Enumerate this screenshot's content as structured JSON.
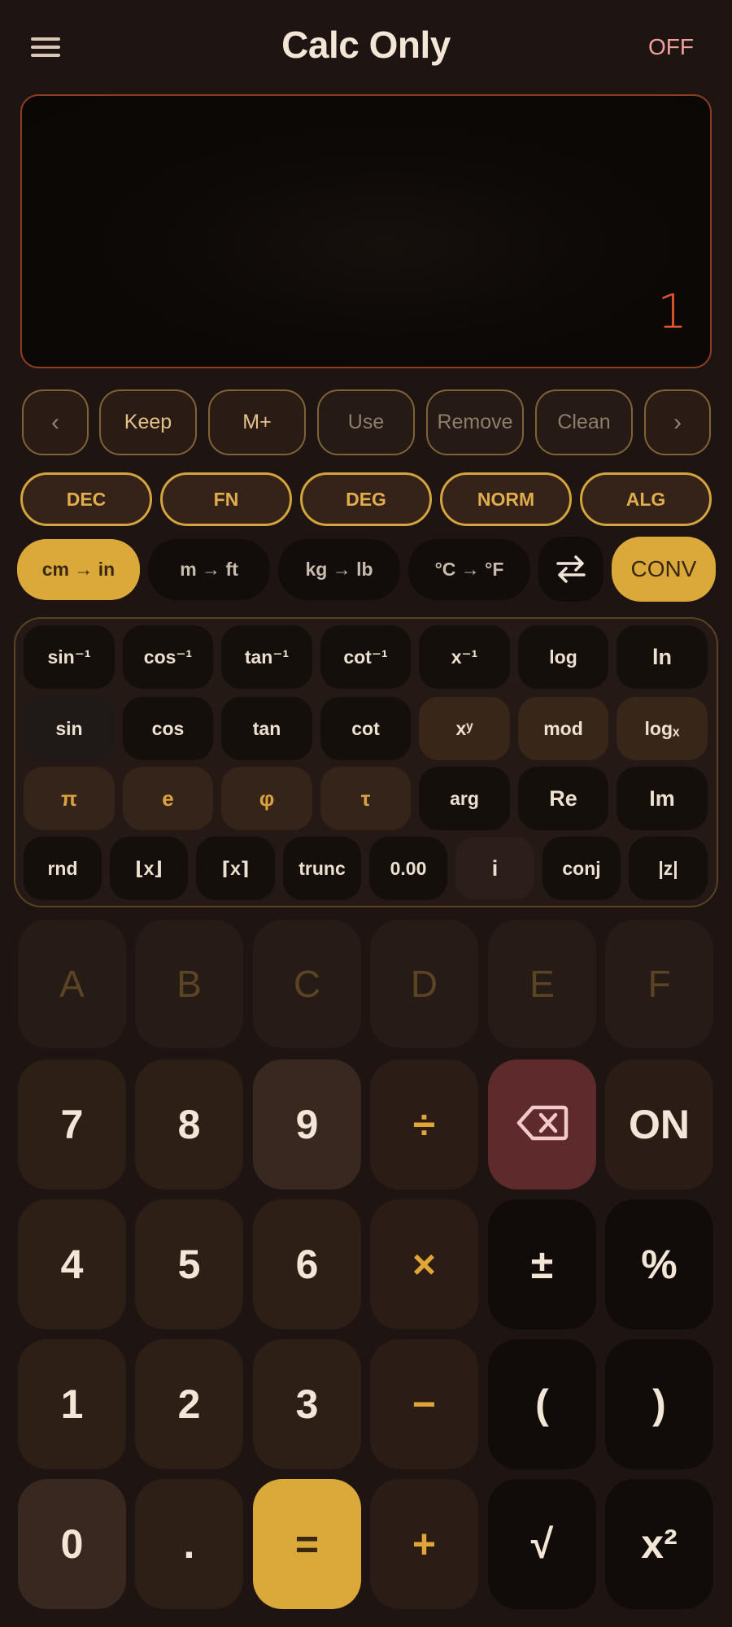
{
  "header": {
    "menu_icon": "hamburger-menu-icon",
    "title": "Calc Only",
    "off_label": "OFF"
  },
  "display": {
    "value": "1"
  },
  "memory": {
    "prev_arrow": "‹",
    "keep": "Keep",
    "mplus": "M+",
    "use": "Use",
    "remove": "Remove",
    "clean": "Clean",
    "next_arrow": "›"
  },
  "modes": [
    "DEC",
    "FN",
    "DEG",
    "NORM",
    "ALG"
  ],
  "units": {
    "cm_in": "cm → in",
    "m_ft": "m → ft",
    "kg_lb": "kg → lb",
    "c_f": "°C → °F",
    "swap_icon": "swap-arrows-icon",
    "conv": "CONV"
  },
  "scientific": {
    "row1": [
      "sin⁻¹",
      "cos⁻¹",
      "tan⁻¹",
      "cot⁻¹",
      "x⁻¹",
      "log",
      "ln"
    ],
    "row2": [
      "sin",
      "cos",
      "tan",
      "cot",
      "xʸ",
      "mod",
      "logₓ"
    ],
    "row3": [
      "π",
      "e",
      "φ",
      "τ",
      "arg",
      "Re",
      "Im"
    ],
    "row4": [
      "rnd",
      "⌊x⌋",
      "⌈x⌉",
      "trunc",
      "0.00",
      "i",
      "conj",
      "|z|"
    ]
  },
  "hex": [
    "A",
    "B",
    "C",
    "D",
    "E",
    "F"
  ],
  "keypad": {
    "row1": [
      "7",
      "8",
      "9",
      "÷",
      "⌫",
      "ON"
    ],
    "row2": [
      "4",
      "5",
      "6",
      "×",
      "±",
      "%"
    ],
    "row3": [
      "1",
      "2",
      "3",
      "−",
      "(",
      ")"
    ],
    "row4": [
      "0",
      ".",
      "=",
      "+",
      "√",
      "x²"
    ]
  },
  "colors": {
    "background": "#1e1512",
    "accent_gold": "#dba93a",
    "display_value": "#e0552b",
    "backspace": "#5e2a2c"
  }
}
